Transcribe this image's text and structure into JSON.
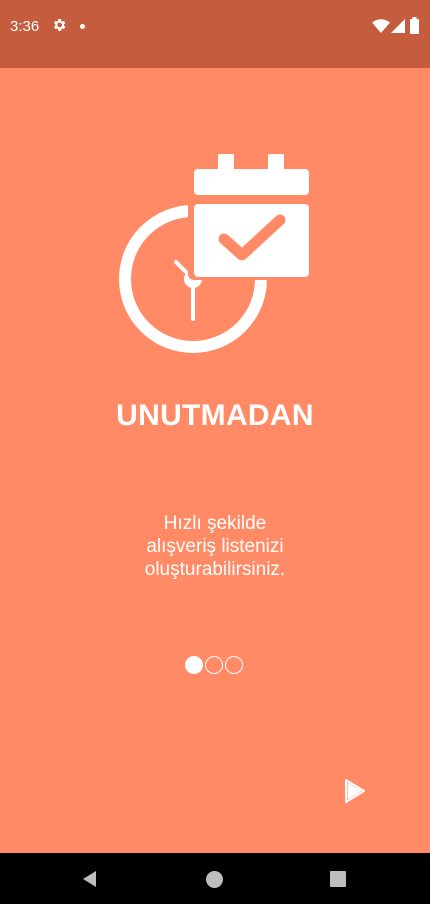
{
  "status_bar": {
    "time": "3:36",
    "icons": [
      "gear-icon",
      "dot-icon",
      "wifi-icon",
      "signal-icon",
      "battery-icon"
    ],
    "background": "#c45c3d"
  },
  "onboarding": {
    "icon": "calendar-clock-check-icon",
    "title": "UNUTMADAN",
    "description_lines": [
      "Hızlı şekilde",
      "alışveriş listenizi",
      "oluşturabilirsiniz."
    ],
    "page_indicator": {
      "total": 3,
      "active": 1
    },
    "next_icon": "play-arrow-icon",
    "background": "#ff8a65"
  },
  "nav_bar": {
    "buttons": [
      "back-icon",
      "home-icon",
      "recents-icon"
    ]
  }
}
